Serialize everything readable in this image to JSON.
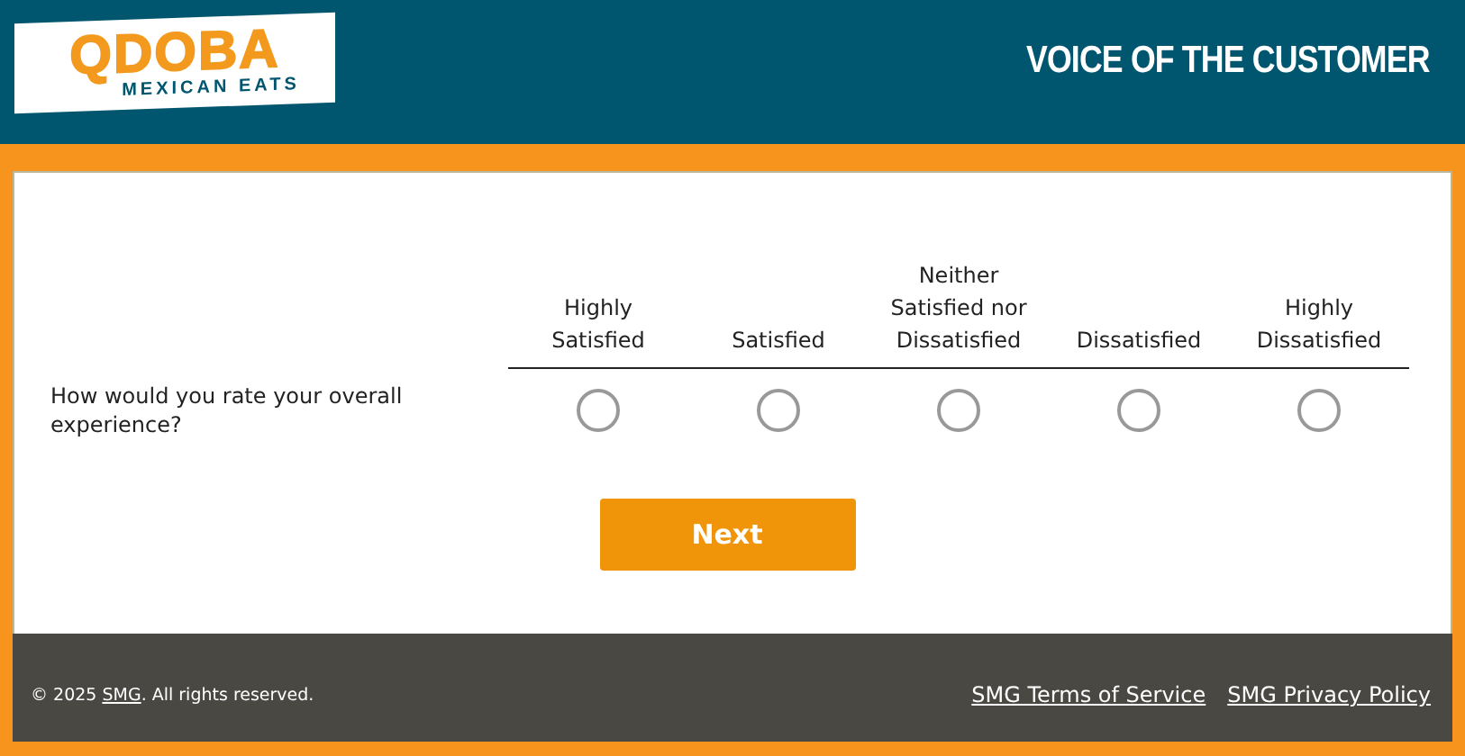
{
  "header": {
    "logo": {
      "name": "QDOBA",
      "tagline": "MEXICAN EATS"
    },
    "title": "VOICE OF THE CUSTOMER"
  },
  "survey": {
    "columns": [
      "Highly\nSatisfied",
      "Satisfied",
      "Neither\nSatisfied nor\nDissatisfied",
      "Dissatisfied",
      "Highly\nDissatisfied"
    ],
    "questions": [
      {
        "text": "How would you rate your overall experience?",
        "options": [
          {
            "selected": false
          },
          {
            "selected": false
          },
          {
            "selected": false
          },
          {
            "selected": false
          },
          {
            "selected": false
          }
        ]
      }
    ],
    "next_button": "Next"
  },
  "footer": {
    "copyright_prefix": "© 2025 ",
    "copyright_link": "SMG",
    "copyright_suffix": ". All rights reserved.",
    "links": [
      "SMG Terms of Service",
      "SMG Privacy Policy"
    ]
  }
}
